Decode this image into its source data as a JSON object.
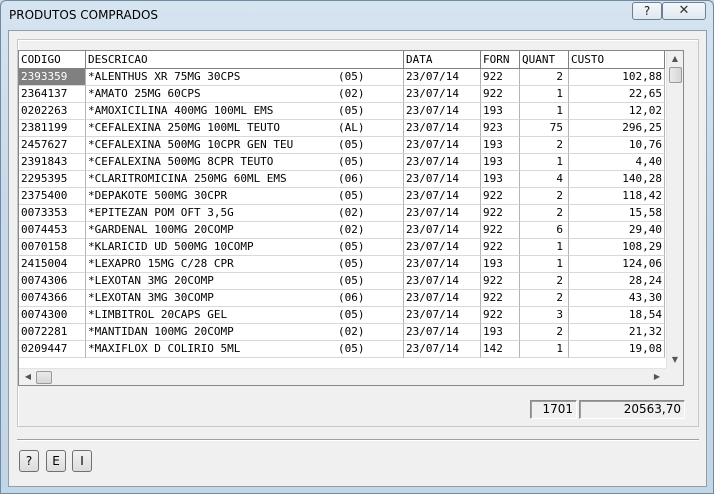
{
  "window": {
    "title": "PRODUTOS COMPRADOS",
    "help_label": "?",
    "close_label": "✕"
  },
  "grid": {
    "columns": [
      "CODIGO",
      "DESCRICAO",
      "DATA",
      "FORN",
      "QUANT",
      "CUSTO"
    ],
    "rows": [
      {
        "codigo": "2393359",
        "name": "*ALENTHUS XR 75MG 30CPS",
        "code": "(05)",
        "data": "23/07/14",
        "forn": "922",
        "quant": "2",
        "custo": "102,88"
      },
      {
        "codigo": "2364137",
        "name": "*AMATO 25MG 60CPS",
        "code": "(02)",
        "data": "23/07/14",
        "forn": "922",
        "quant": "1",
        "custo": "22,65"
      },
      {
        "codigo": "0202263",
        "name": "*AMOXICILINA 400MG 100ML EMS",
        "code": "(05)",
        "data": "23/07/14",
        "forn": "193",
        "quant": "1",
        "custo": "12,02"
      },
      {
        "codigo": "2381199",
        "name": "*CEFALEXINA 250MG 100ML TEUTO",
        "code": "(AL)",
        "data": "23/07/14",
        "forn": "923",
        "quant": "75",
        "custo": "296,25"
      },
      {
        "codigo": "2457627",
        "name": "*CEFALEXINA 500MG 10CPR GEN TEU",
        "code": "(05)",
        "data": "23/07/14",
        "forn": "193",
        "quant": "2",
        "custo": "10,76"
      },
      {
        "codigo": "2391843",
        "name": "*CEFALEXINA 500MG 8CPR TEUTO",
        "code": "(05)",
        "data": "23/07/14",
        "forn": "193",
        "quant": "1",
        "custo": "4,40"
      },
      {
        "codigo": "2295395",
        "name": "*CLARITROMICINA 250MG 60ML EMS",
        "code": "(06)",
        "data": "23/07/14",
        "forn": "193",
        "quant": "4",
        "custo": "140,28"
      },
      {
        "codigo": "2375400",
        "name": "*DEPAKOTE 500MG 30CPR",
        "code": "(05)",
        "data": "23/07/14",
        "forn": "922",
        "quant": "2",
        "custo": "118,42"
      },
      {
        "codigo": "0073353",
        "name": "*EPITEZAN POM OFT 3,5G",
        "code": "(02)",
        "data": "23/07/14",
        "forn": "922",
        "quant": "2",
        "custo": "15,58"
      },
      {
        "codigo": "0074453",
        "name": "*GARDENAL 100MG 20COMP",
        "code": "(02)",
        "data": "23/07/14",
        "forn": "922",
        "quant": "6",
        "custo": "29,40"
      },
      {
        "codigo": "0070158",
        "name": "*KLARICID UD 500MG 10COMP",
        "code": "(05)",
        "data": "23/07/14",
        "forn": "922",
        "quant": "1",
        "custo": "108,29"
      },
      {
        "codigo": "2415004",
        "name": "*LEXAPRO 15MG C/28 CPR",
        "code": "(05)",
        "data": "23/07/14",
        "forn": "193",
        "quant": "1",
        "custo": "124,06"
      },
      {
        "codigo": "0074306",
        "name": "*LEXOTAN 3MG 20COMP",
        "code": "(05)",
        "data": "23/07/14",
        "forn": "922",
        "quant": "2",
        "custo": "28,24"
      },
      {
        "codigo": "0074366",
        "name": "*LEXOTAN 3MG 30COMP",
        "code": "(06)",
        "data": "23/07/14",
        "forn": "922",
        "quant": "2",
        "custo": "43,30"
      },
      {
        "codigo": "0074300",
        "name": "*LIMBITROL 20CAPS GEL",
        "code": "(05)",
        "data": "23/07/14",
        "forn": "922",
        "quant": "3",
        "custo": "18,54"
      },
      {
        "codigo": "0072281",
        "name": "*MANTIDAN 100MG 20COMP",
        "code": "(02)",
        "data": "23/07/14",
        "forn": "193",
        "quant": "2",
        "custo": "21,32"
      },
      {
        "codigo": "0209447",
        "name": "*MAXIFLOX D COLIRIO 5ML",
        "code": "(05)",
        "data": "23/07/14",
        "forn": "142",
        "quant": "1",
        "custo": "19,08"
      }
    ],
    "selected_row": 0,
    "scroll_up": "▲",
    "scroll_down": "▼",
    "scroll_left": "◀",
    "scroll_right": "▶"
  },
  "totals": {
    "quant_total": "1701",
    "custo_total": "20563,70"
  },
  "buttons": {
    "help": "?",
    "e": "E",
    "i": "I"
  }
}
